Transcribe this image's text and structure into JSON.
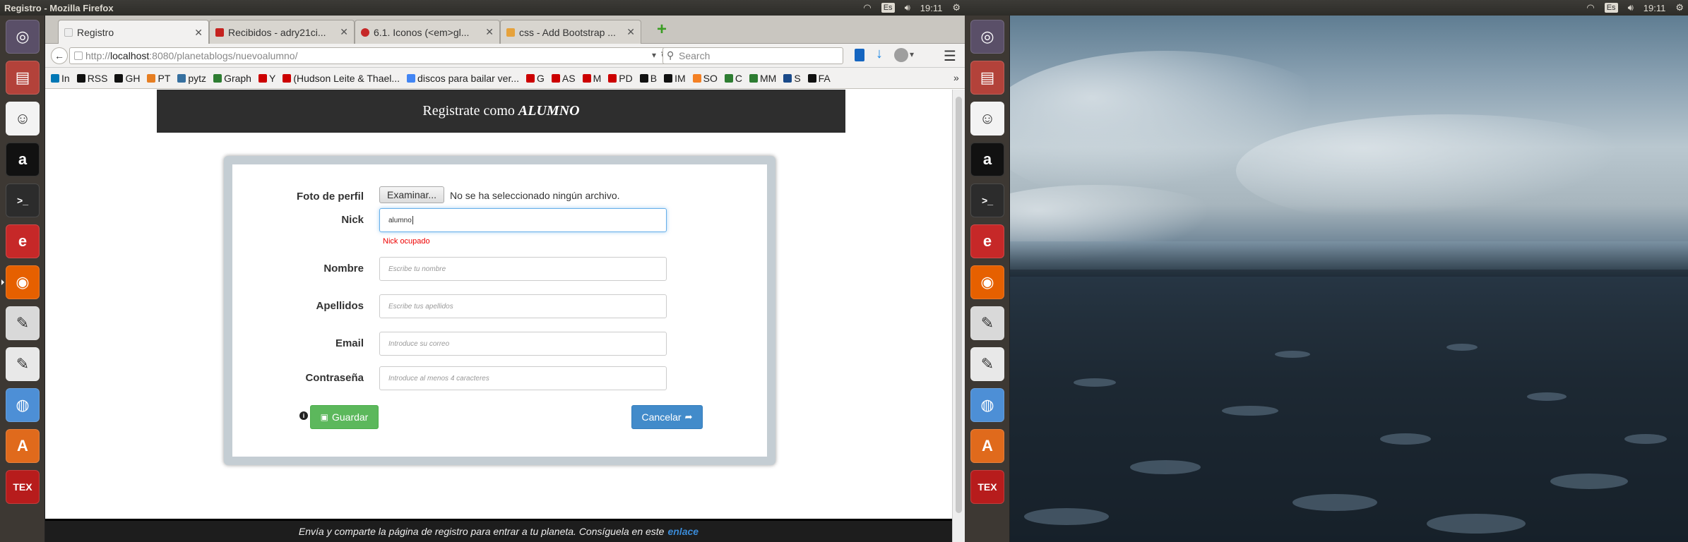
{
  "left_panel": {
    "window_title": "Registro - Mozilla Firefox",
    "keyboard": "Es",
    "time": "19:11"
  },
  "right_panel": {
    "keyboard": "Es",
    "time": "19:11"
  },
  "launcher_items": [
    {
      "name": "ubuntu-dash",
      "glyph": "◎",
      "color": "#5a4f68"
    },
    {
      "name": "files",
      "glyph": "▤",
      "color": "#b3423a"
    },
    {
      "name": "app-robot",
      "glyph": "☺",
      "color": "#f3f3f3"
    },
    {
      "name": "amazon",
      "glyph": "a",
      "color": "#111111"
    },
    {
      "name": "terminal",
      "glyph": ">_",
      "color": "#2c2c2c"
    },
    {
      "name": "app-e",
      "glyph": "e",
      "color": "#c62828"
    },
    {
      "name": "firefox",
      "glyph": "◉",
      "color": "#e66000"
    },
    {
      "name": "text-editor",
      "glyph": "✎",
      "color": "#d9d9d9"
    },
    {
      "name": "text-editor-2",
      "glyph": "✎",
      "color": "#e8e8e8"
    },
    {
      "name": "chromium",
      "glyph": "◍",
      "color": "#4d8fd6"
    },
    {
      "name": "software-center",
      "glyph": "A",
      "color": "#e06a1c"
    },
    {
      "name": "tex",
      "glyph": "TEX",
      "color": "#b71c1c"
    }
  ],
  "tabs": [
    {
      "label": "Registro",
      "active": true,
      "color": "#ddd"
    },
    {
      "label": "Recibidos - adry21ci...",
      "active": false,
      "color": "#c5221f"
    },
    {
      "label": "6.1. Iconos (<em>gl...",
      "active": false,
      "color": "#c62828"
    },
    {
      "label": "css - Add Bootstrap ...",
      "active": false,
      "color": "#e6a23c"
    }
  ],
  "url": {
    "prefix": "http://",
    "host": "localhost",
    "path": ":8080/planetablogs/nuevoalumno/"
  },
  "search_placeholder": "Search",
  "bookmarks": [
    {
      "label": "In",
      "color": "#0077b5"
    },
    {
      "label": "RSS",
      "color": "#111"
    },
    {
      "label": "GH",
      "color": "#111"
    },
    {
      "label": "PT",
      "color": "#e67e22"
    },
    {
      "label": "pytz",
      "color": "#3670a0"
    },
    {
      "label": "Graph",
      "color": "#2e7d32"
    },
    {
      "label": "Y",
      "color": "#c00"
    },
    {
      "label": "(Hudson Leite & Thael...",
      "color": "#c00"
    },
    {
      "label": "discos para bailar ver...",
      "color": "#4285f4"
    },
    {
      "label": "G",
      "color": "#c00"
    },
    {
      "label": "AS",
      "color": "#c00"
    },
    {
      "label": "M",
      "color": "#c00"
    },
    {
      "label": "PD",
      "color": "#c00"
    },
    {
      "label": "B",
      "color": "#111"
    },
    {
      "label": "IM",
      "color": "#111"
    },
    {
      "label": "SO",
      "color": "#f48024"
    },
    {
      "label": "C",
      "color": "#2e7d32"
    },
    {
      "label": "MM",
      "color": "#2e7d32"
    },
    {
      "label": "S",
      "color": "#1a4a8a"
    },
    {
      "label": "FA",
      "color": "#111"
    }
  ],
  "page": {
    "header": {
      "text": "Registrate como",
      "em": "ALUMNO"
    },
    "form": {
      "photo_label": "Foto de perfil",
      "file_button": "Examinar...",
      "file_status": "No se ha seleccionado ningún archivo.",
      "nick_label": "Nick",
      "nick_value": "alumno",
      "nick_error": "Nick ocupado",
      "nombre_label": "Nombre",
      "nombre_placeholder": "Escribe tu nombre",
      "apellidos_label": "Apellidos",
      "apellidos_placeholder": "Escribe tus apellidos",
      "email_label": "Email",
      "email_placeholder": "Introduce su correo",
      "password_label": "Contraseña",
      "password_placeholder": "Introduce al menos 4 caracteres",
      "save_label": "Guardar",
      "cancel_label": "Cancelar"
    },
    "footer": {
      "text": "Envía y comparte la página de registro para entrar a tu planeta. Consíguela en este",
      "link": "enlace"
    }
  },
  "colors": {
    "save": "#5cb85c",
    "cancel": "#428bca",
    "error": "#e00000"
  }
}
